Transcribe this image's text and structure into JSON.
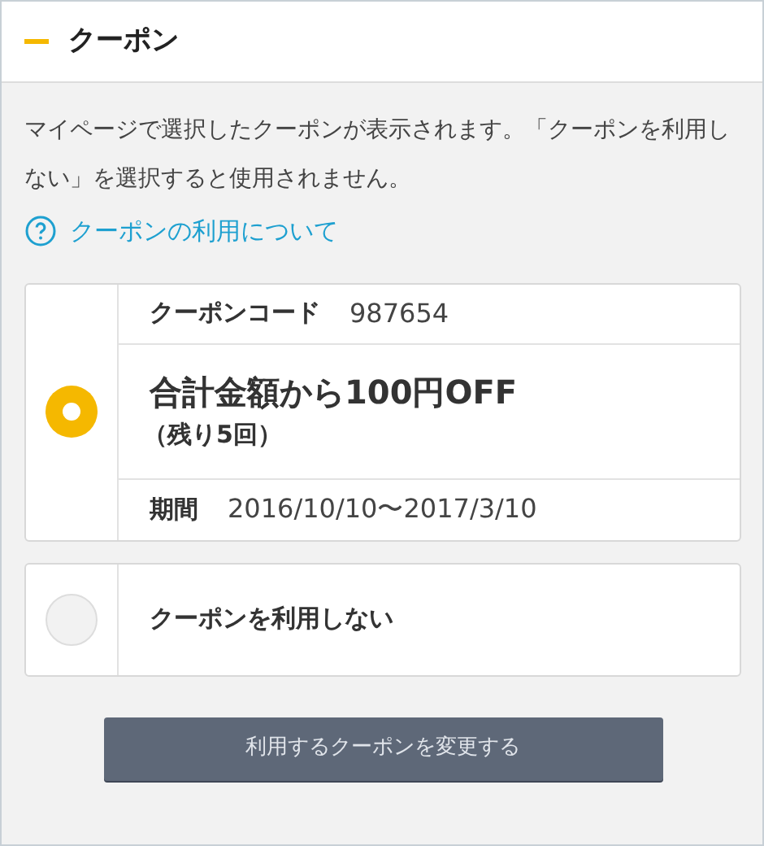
{
  "header": {
    "title": "クーポン"
  },
  "description": "マイページで選択したクーポンが表示されます。「クーポンを利用しない」を選択すると使用されません。",
  "help_link": "クーポンの利用について",
  "options": [
    {
      "kind": "coupon",
      "selected": true,
      "code_label": "クーポンコード",
      "code": "987654",
      "title": "合計金額から100円OFF",
      "remaining": "（残り5回）",
      "period_label": "期間",
      "period": "2016/10/10〜2017/3/10"
    },
    {
      "kind": "none",
      "selected": false,
      "label": "クーポンを利用しない"
    }
  ],
  "button": "利用するクーポンを変更する"
}
